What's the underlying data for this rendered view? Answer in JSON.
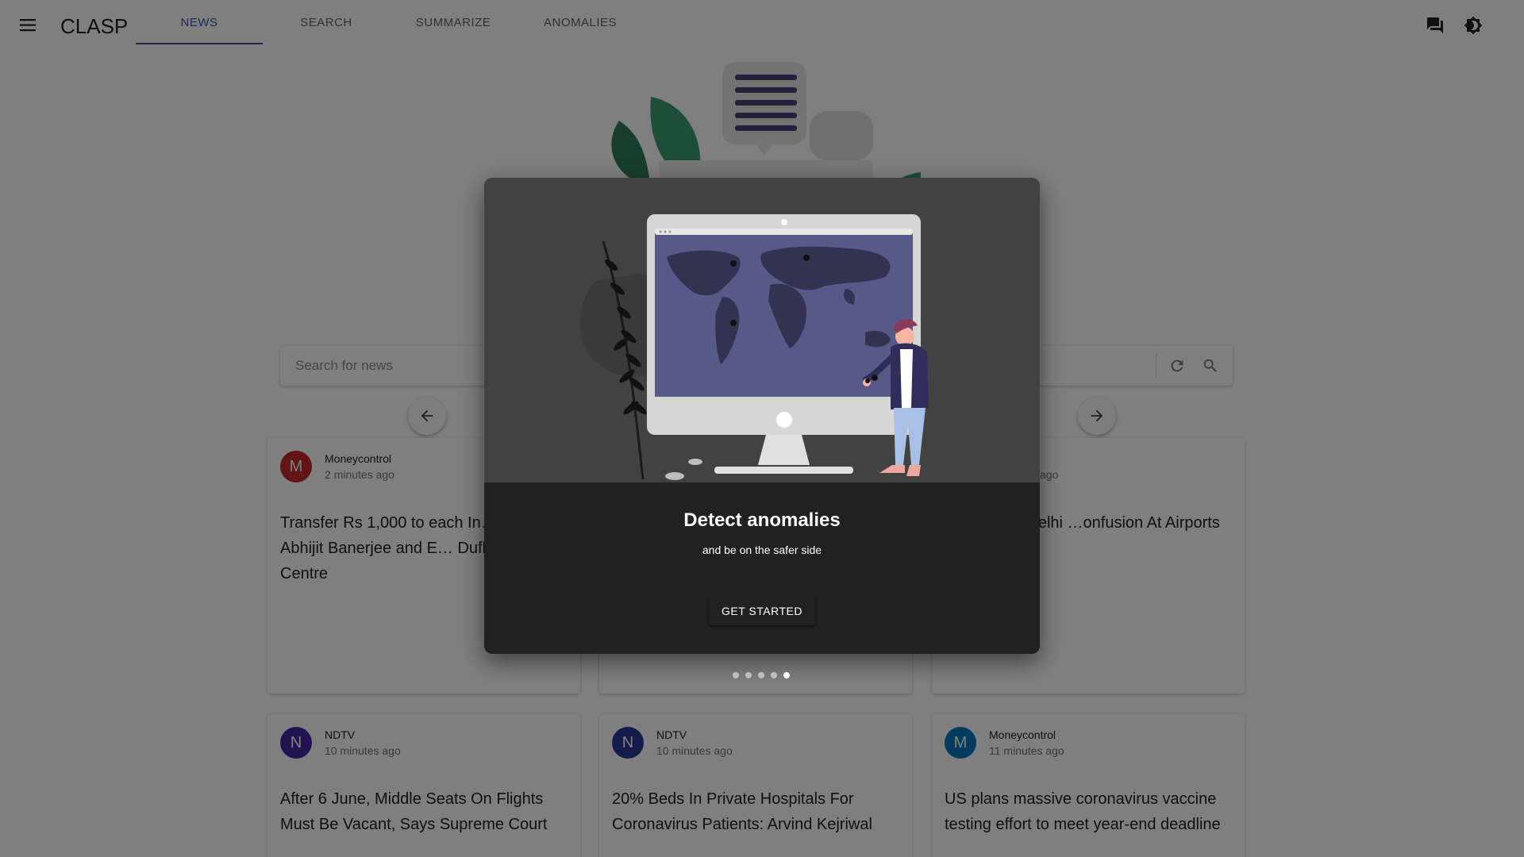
{
  "app": {
    "brand": "CLASP"
  },
  "tabs": [
    {
      "label": "NEWS",
      "active": true
    },
    {
      "label": "SEARCH",
      "active": false
    },
    {
      "label": "SUMMARIZE",
      "active": false
    },
    {
      "label": "ANOMALIES",
      "active": false
    }
  ],
  "icons": {
    "menu": "menu-icon",
    "feedback": "forum-icon",
    "theme": "brightness-icon",
    "refresh": "refresh-icon",
    "search": "search-icon",
    "prev": "arrow-left-icon",
    "next": "arrow-right-icon"
  },
  "search": {
    "placeholder": "Search for news"
  },
  "cards": [
    {
      "source": "Moneycontrol",
      "time": "2 minutes ago",
      "title": "Transfer Rs 1,000 to each In… month: Abhijit Banerjee and E… Duflo suggest Centre",
      "avatar": "M",
      "color": "#c62828"
    },
    {
      "source": "",
      "time": "",
      "title": "",
      "avatar": "",
      "color": "#3f51b5"
    },
    {
      "source": "",
      "time": "ago",
      "title": "0 Flights In Delhi …onfusion At Airports",
      "avatar": "",
      "color": "#3f51b5"
    },
    {
      "source": "NDTV",
      "time": "10 minutes ago",
      "title": "After 6 June, Middle Seats On Flights Must Be Vacant, Says Supreme Court",
      "avatar": "N",
      "color": "#4527a0"
    },
    {
      "source": "NDTV",
      "time": "10 minutes ago",
      "title": "20% Beds In Private Hospitals For Coronavirus Patients: Arvind Kejriwal",
      "avatar": "N",
      "color": "#283593"
    },
    {
      "source": "Moneycontrol",
      "time": "11 minutes ago",
      "title": "US plans massive coronavirus vaccine testing effort to meet year-end deadline",
      "avatar": "M",
      "color": "#0277bd"
    }
  ],
  "dialog": {
    "title": "Detect anomalies",
    "subtitle": "and be on the safer side",
    "button": "GET STARTED",
    "step_count": 5,
    "active_step": 5
  },
  "colors": {
    "primary": "#3f51b5",
    "dialog_bg": "#212121",
    "media_bg": "#424242",
    "monitor_screen": "#575a89"
  }
}
